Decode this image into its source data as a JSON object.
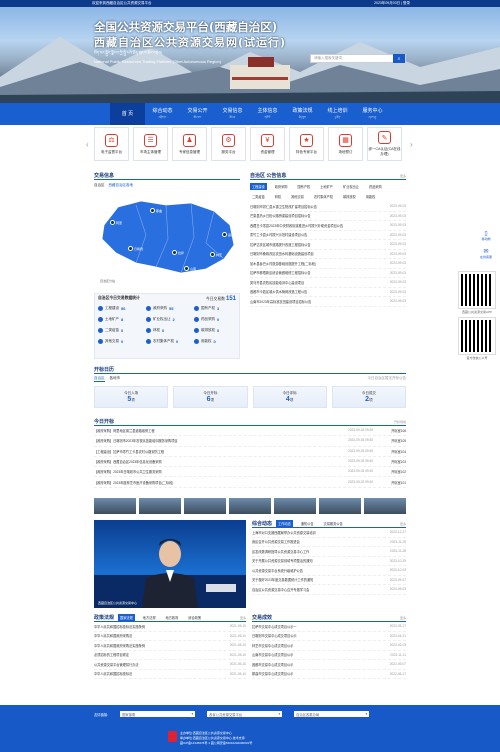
{
  "topbar": {
    "left": "欢迎来到西藏自治区公共资源交易平台",
    "right": "2023年09月03日  | 登录"
  },
  "header": {
    "title_cn": "全国公共资源交易平台(西藏自治区)",
    "title_cn2": "西藏自治区公共资源交易网(试运行)",
    "title_tibetan": "བོད་རང་སྐྱོང་ལྗོངས་ཀྱི་སྤྱི་པའི་ཐོན་ཁུངས་ཚོང་འབྲེལ།",
    "title_en": "National Public Resources Trading Platform (Tibet Autonomous Region)",
    "search_placeholder": "请输入搜索关键词"
  },
  "nav": [
    {
      "label": "首 页",
      "sub": ""
    },
    {
      "label": "综合动态",
      "sub": "འགྲོས་ཁ་"
    },
    {
      "label": "交易公开",
      "sub": "ཚོང་ལས་"
    },
    {
      "label": "交易信息",
      "sub": "ཚོང་ཆ་"
    },
    {
      "label": "主体信息",
      "sub": "གཙོ་བོ་"
    },
    {
      "label": "政策法规",
      "sub": "སྲིད་ཇུས་"
    },
    {
      "label": "线上培训",
      "sub": "དྲ་ཐོག་"
    },
    {
      "label": "服务中心",
      "sub": "ཞབས་ཞུ་"
    }
  ],
  "quick": [
    "电子监督平台",
    "市场主体管理",
    "专家信息管理",
    "服务平台",
    "资金管理",
    "特色专家平台",
    "场地预订",
    "综一CA认证(CA在线办理)"
  ],
  "map": {
    "title": "交易信息",
    "label": "自治区",
    "legend": "西藏自治区各地",
    "places": [
      "阿里",
      "那曲",
      "日喀则",
      "拉萨",
      "山南",
      "林芝",
      "昌都"
    ],
    "footer": "自治区分站"
  },
  "stats": {
    "title": "自治区今日交易数据统计",
    "count_label": "今日交易数",
    "count": "151",
    "rows": [
      [
        {
          "l": "工程建设",
          "v": "56"
        },
        {
          "l": "政府采购",
          "v": "55"
        },
        {
          "l": "国有产权",
          "v": "3"
        }
      ],
      [
        {
          "l": "土地矿产",
          "v": "8"
        },
        {
          "l": "矿业权出让",
          "v": "2"
        },
        {
          "l": "药品采购",
          "v": "0"
        }
      ],
      [
        {
          "l": "二类疫苗",
          "v": "0"
        },
        {
          "l": "林权",
          "v": "0"
        },
        {
          "l": "碳排放权",
          "v": "0"
        }
      ],
      [
        {
          "l": "其他交易",
          "v": "0"
        },
        {
          "l": "农村集体产权",
          "v": "0"
        },
        {
          "l": "用能权",
          "v": "0"
        }
      ]
    ]
  },
  "notices": {
    "title": "自治区 公告信息",
    "more": "更多",
    "tabs": [
      "工程建设",
      "政府采购",
      "国有产权",
      "土地矿产",
      "矿业权出让",
      "药品采购"
    ],
    "tabs2": [
      "二类疫苗",
      "林权",
      "其他交易",
      "农村集体产权",
      "碳排放权",
      "用能权"
    ],
    "items": [
      {
        "t": "日喀则市昂仁县乡镇卫生院改扩建项目招标公告",
        "d": "2023-09-03"
      },
      {
        "t": "芒康县热乡日松公路桥梁建设项目招标公告",
        "d": "2023-09-03"
      },
      {
        "t": "西藏日卡墨县2023年中央财政衔接推进乡村振兴补助资金项目公告",
        "d": "2023-09-03"
      },
      {
        "t": "墨竹工卡县乡村振兴示范村建设项目公告",
        "d": "2023-09-03"
      },
      {
        "t": "拉萨达孜区城市道路提升改造工程招标公告",
        "d": "2023-09-03"
      },
      {
        "t": "日喀则市桑珠孜区农田水利基础设施建设项目",
        "d": "2023-09-03"
      },
      {
        "t": "尼木县吞巴乡村旅游基础设施提升工程(二标段)",
        "d": "2023-09-03"
      },
      {
        "t": "拉萨市柳梧新区综合管廊维修工程招标公告",
        "d": "2023-09-03"
      },
      {
        "t": "类乌齐县农牧民技能培训中心建设项目",
        "d": "2023-09-03"
      },
      {
        "t": "昌都市卡若区城乡供水管网改造工程公告",
        "d": "2023-09-03"
      },
      {
        "t": "山南市2023年高标准农田建设项目招标公告",
        "d": "2023-09-03"
      }
    ]
  },
  "calendar": {
    "title": "开标日历",
    "tabs": [
      "自治区",
      "各地市"
    ],
    "note": "今日自治区暂无开标公告",
    "cards": [
      {
        "l": "今日入场",
        "v": "5",
        "u": "项"
      },
      {
        "l": "今日开标",
        "v": "6",
        "u": "项"
      },
      {
        "l": "今日评标",
        "v": "4",
        "u": "项"
      },
      {
        "l": "今日成交",
        "v": "2",
        "u": "项"
      }
    ]
  },
  "today": {
    "title": "今日开标",
    "more": "开标场地",
    "items": [
      {
        "t": "【政府采购】阿里地区普兰县道路维修工程",
        "d": "2023-09-03 09:30",
        "r": "开标室106"
      },
      {
        "t": "【政府采购】日喀则市2023年农牧民技能培训服务采购项目",
        "d": "2023-09-03 09:30",
        "r": "开标室105"
      },
      {
        "t": "【工程建设】拉萨市墨竹工卡县农村公路安防工程",
        "d": "2023-09-03 09:30",
        "r": "开标室104"
      },
      {
        "t": "【政府采购】西藏自治区2023年信息化设备采购",
        "d": "2023-09-03 09:30",
        "r": "开标室103"
      },
      {
        "t": "【政府采购】2023年日喀则市公共卫生服务采购",
        "d": "2023-09-03 09:30",
        "r": "开标室102"
      },
      {
        "t": "【政府采购】2023年度林芝市医疗设备采购项目(二标段)",
        "d": "2023-09-03 09:30",
        "r": "开标室101"
      }
    ]
  },
  "video": {
    "caption": "西藏自治区公共资源交易中心"
  },
  "news": {
    "title": "综合动态",
    "tabs": [
      "工作动态",
      "通知公告",
      "交易服务公告"
    ],
    "more": "更多",
    "items": [
      {
        "t": "上海市对口支援西藏局举办公共资源交易培训",
        "d": "2023-12-27"
      },
      {
        "t": "我区召开公共资源交易工作推进会",
        "d": "2023-11-29"
      },
      {
        "t": "区发改委调研指导公共资源交易中心工作",
        "d": "2023-11-28"
      },
      {
        "t": "关于开展公共资源交易领域专项整治的通知",
        "d": "2023-10-29"
      },
      {
        "t": "公共资源交易平台系统升级维护公告",
        "d": "2023-10-03"
      },
      {
        "t": "关于做好2023年度交易数据统计工作的通知",
        "d": "2023-09-07"
      },
      {
        "t": "自治区公共资源交易中心召开专题学习会",
        "d": "2023-09-03"
      }
    ]
  },
  "policy": {
    "title": "政策法规",
    "tabs": [
      "国家法规",
      "地方法规",
      "地方政府",
      "综合政策"
    ],
    "more": "更多",
    "items": [
      {
        "t": "中华人民共和国招标投标法实施条例",
        "d": "2021-05-10"
      },
      {
        "t": "中华人民共和国政府采购法",
        "d": "2021-05-10"
      },
      {
        "t": "中华人民共和国政府采购法实施条例",
        "d": "2021-05-10"
      },
      {
        "t": "必须招标的工程项目规定",
        "d": "2021-05-10"
      },
      {
        "t": "公共资源交易平台管理暂行办法",
        "d": "2021-05-10"
      },
      {
        "t": "中华人民共和国招标投标法",
        "d": "2021-05-10"
      }
    ]
  },
  "results": {
    "title": "交易成效",
    "more": "更多",
    "items": [
      {
        "t": "拉萨市交易中心成交项目公示一",
        "d": "2023-05-17"
      },
      {
        "t": "日喀则市交易中心成交项目公示",
        "d": "2023-04-21"
      },
      {
        "t": "林芝市交易中心成交项目公示",
        "d": "2023-02-03"
      },
      {
        "t": "山南市交易中心成交项目公示",
        "d": "2022-11-11"
      },
      {
        "t": "昌都市交易中心成交项目公示",
        "d": "2022-09-07"
      },
      {
        "t": "那曲市交易中心成交项目公示",
        "d": "2022-06-17"
      }
    ]
  },
  "footer": {
    "links_label": "友情链接:",
    "sel1": "国家部委",
    "sel2": "各省公共资源交易平台",
    "sel3": "自治区各委办局",
    "copy1": "主办单位:西藏自治区公共资源交易中心",
    "copy2": "承办单位:西藏自治区公共资源交易中心  技术支持:",
    "copy3": "藏ICP备12345678号-1  藏公网安备54010202000001号"
  },
  "side": {
    "s1": "移动端",
    "s2": "在线客服",
    "qr1": "西藏公共资源交易APP",
    "qr2": "官方微信公众号"
  }
}
